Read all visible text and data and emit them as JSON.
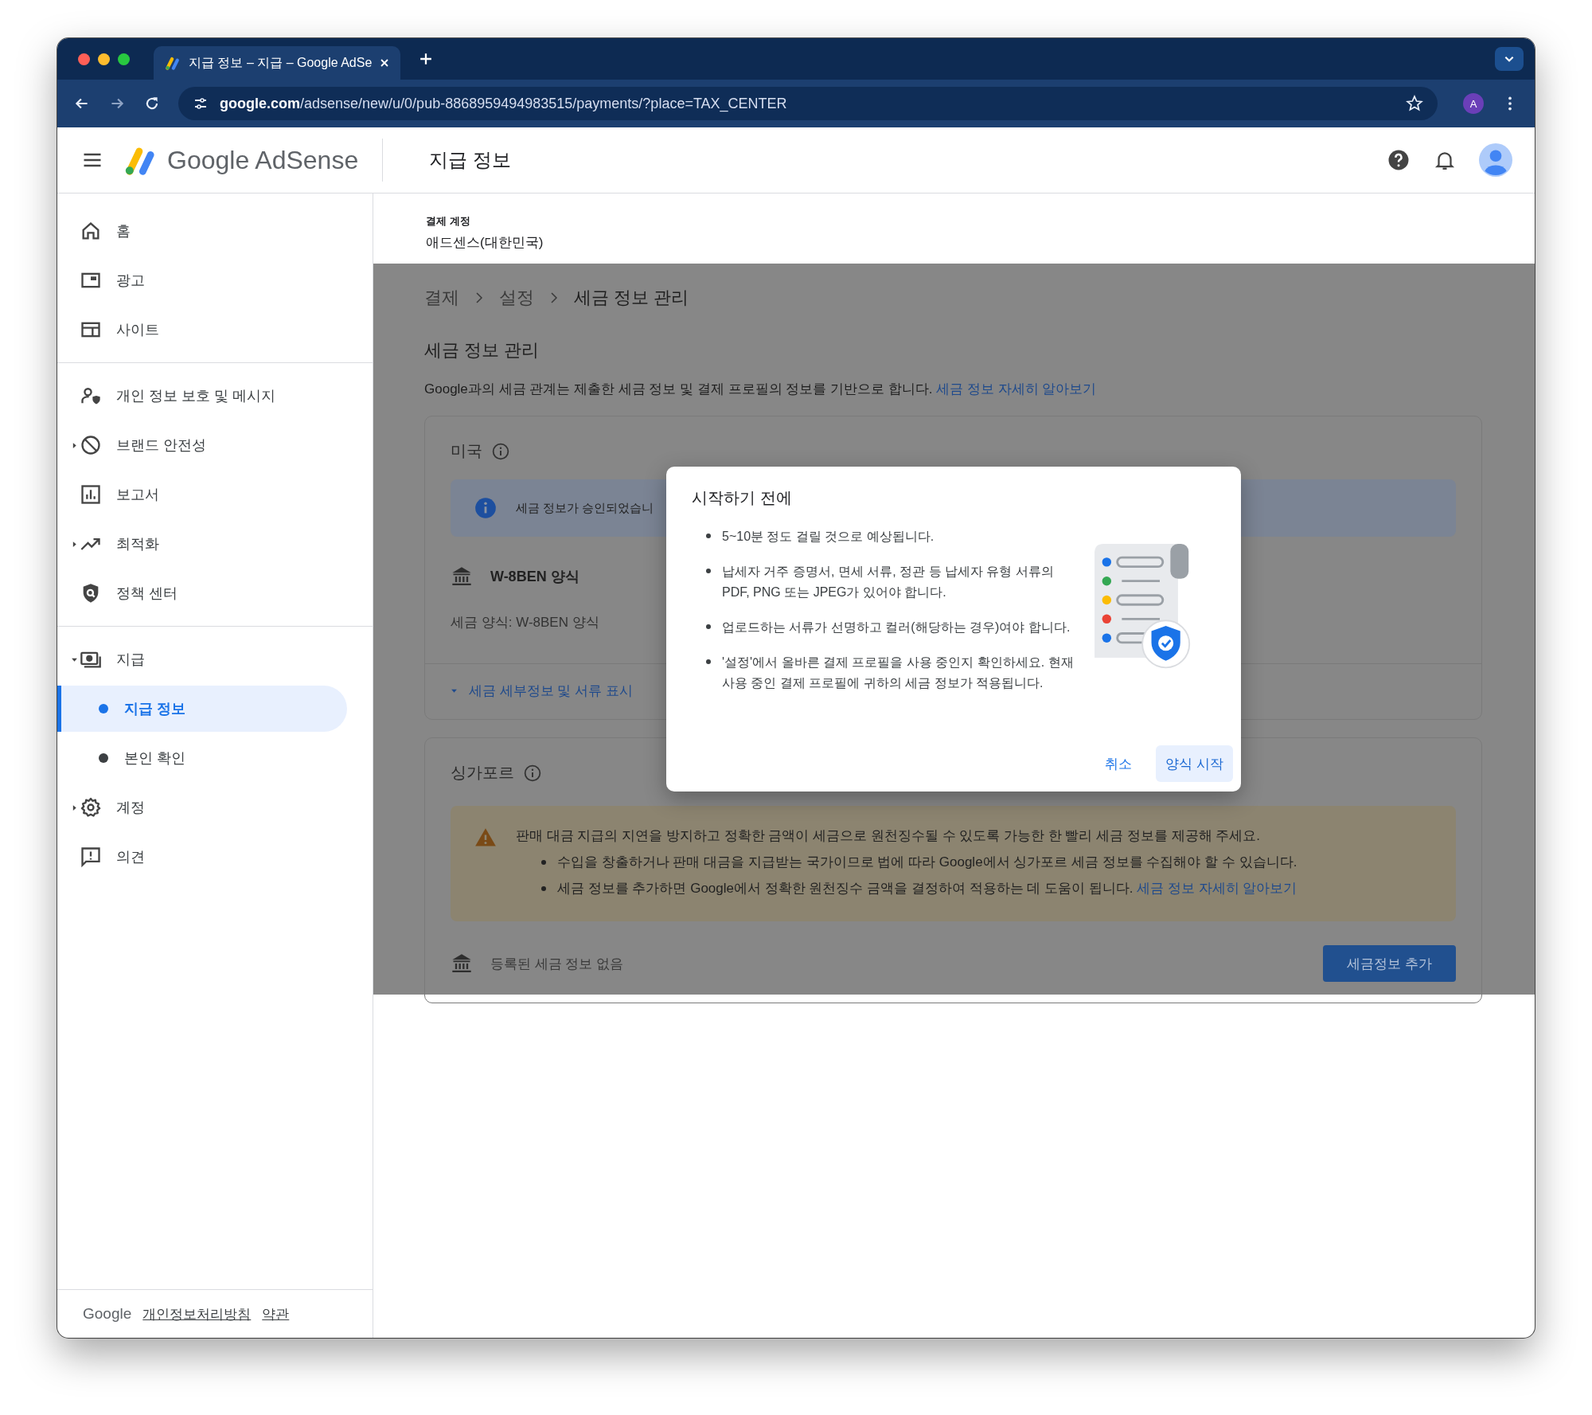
{
  "browser": {
    "tab_title": "지급 정보 – 지급 – Google AdSe",
    "url_host": "google.com",
    "url_path": "/adsense/new/u/0/pub-8868959494983515/payments/?place=TAX_CENTER",
    "profile_initial": "A"
  },
  "header": {
    "brand": "Google AdSense",
    "title": "지급 정보"
  },
  "sidebar": {
    "groups": [
      [
        {
          "label": "홈"
        },
        {
          "label": "광고"
        },
        {
          "label": "사이트"
        }
      ],
      [
        {
          "label": "개인 정보 보호 및 메시지"
        },
        {
          "label": "브랜드 안전성",
          "expanded": false
        },
        {
          "label": "보고서"
        },
        {
          "label": "최적화",
          "expanded": false
        },
        {
          "label": "정책 센터"
        }
      ],
      [
        {
          "label": "지급",
          "expanded": true,
          "children": [
            {
              "label": "지급 정보",
              "selected": true
            },
            {
              "label": "본인 확인",
              "selected": false
            }
          ]
        },
        {
          "label": "계정",
          "expanded": false
        },
        {
          "label": "의견"
        }
      ]
    ],
    "footer": {
      "brand": "Google",
      "links": [
        "개인정보처리방침",
        "약관"
      ]
    }
  },
  "account": {
    "label": "결제 계정",
    "value": "애드센스(대한민국)"
  },
  "breadcrumb": [
    "결제",
    "설정",
    "세금 정보 관리"
  ],
  "page_title": "세금 정보 관리",
  "description": {
    "text": "Google과의 세금 관계는 제출한 세금 정보 및 결제 프로필의 정보를 기반으로 합니다. ",
    "link": "세금 정보 자세히 알아보기"
  },
  "countries": [
    {
      "name": "미국",
      "notice": {
        "kind": "info",
        "text": "세금 정보가 승인되었습니"
      },
      "form": {
        "name": "W-8BEN 양식",
        "detail": "세금 양식: W-8BEN 양식"
      },
      "toggle": "세금 세부정보 및 서류 표시"
    },
    {
      "name": "싱가포르",
      "notice": {
        "kind": "warning",
        "text": "판매 대금 지급의 지연을 방지하고 정확한 금액이 세금으로 원천징수될 수 있도록 가능한 한 빨리 세금 정보를 제공해 주세요.",
        "bullets": [
          {
            "text": "수입을 창출하거나 판매 대금을 지급받는 국가이므로 법에 따라 Google에서 싱가포르 세금 정보를 수집해야 할 수 있습니다."
          },
          {
            "text": "세금 정보를 추가하면 Google에서 정확한 원천징수 금액을 결정하여 적용하는 데 도움이 됩니다. ",
            "link": "세금 정보 자세히 알아보기"
          }
        ]
      },
      "empty": "등록된 세금 정보 없음",
      "button": "세금정보 추가"
    }
  ],
  "dialog": {
    "title": "시작하기 전에",
    "bullets": [
      "5~10분 정도 걸릴 것으로 예상됩니다.",
      "납세자 거주 증명서, 면세 서류, 정관 등 납세자 유형 서류의 PDF, PNG 또는 JPEG가 있어야 합니다.",
      "업로드하는 서류가 선명하고 컬러(해당하는 경우)여야 합니다.",
      "'설정'에서 올바른 결제 프로필을 사용 중인지 확인하세요. 현재 사용 중인 결제 프로필에 귀하의 세금 정보가 적용됩니다."
    ],
    "buttons": [
      {
        "label": "취소",
        "kind": "text"
      },
      {
        "label": "양식 시작",
        "kind": "tonal"
      }
    ]
  }
}
